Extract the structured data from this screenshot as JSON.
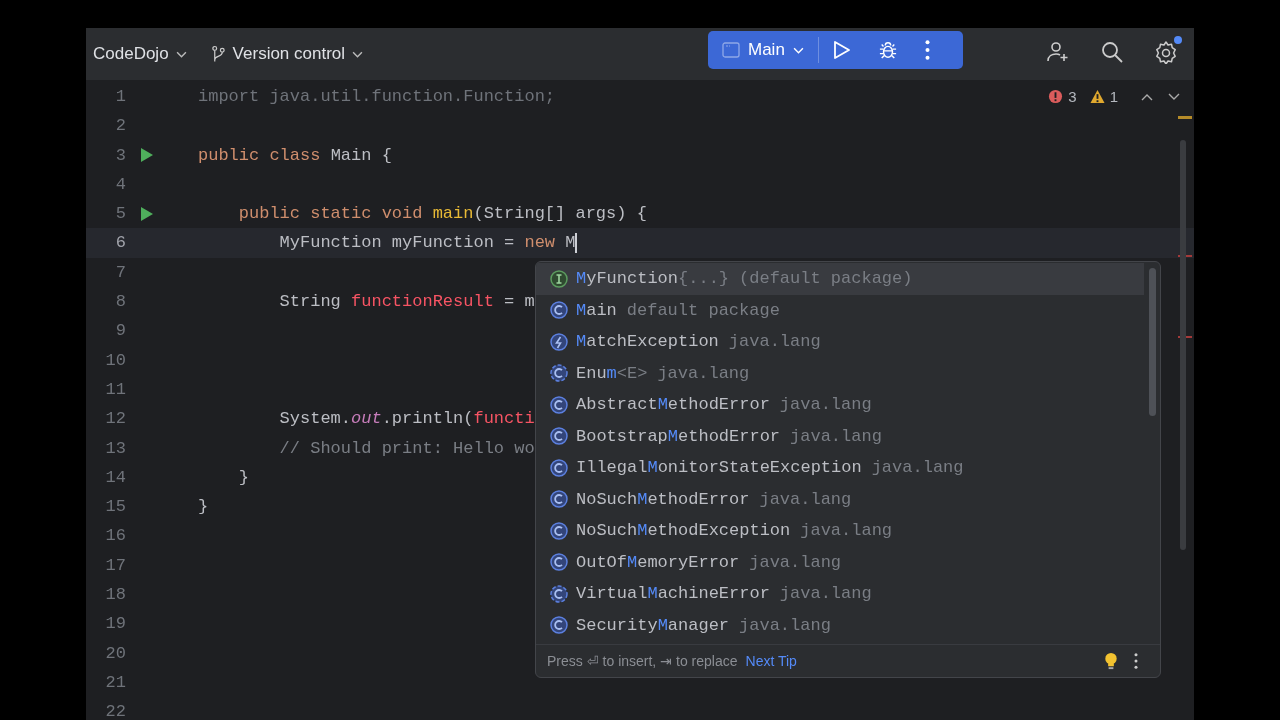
{
  "toolbar": {
    "project": "CodeDojo",
    "vcs": "Version control",
    "run_config": "Main",
    "settings_badge": true
  },
  "inspections": {
    "errors": "3",
    "warnings": "1"
  },
  "lines": [
    {
      "number": "1",
      "run": false,
      "current": false,
      "tokens": [
        {
          "kind": "unused",
          "text": "import java.util.function.Function;"
        }
      ]
    },
    {
      "number": "2",
      "run": false,
      "current": false
    },
    {
      "number": "3",
      "run": true,
      "current": false,
      "tokens": [
        {
          "kind": "keyword",
          "text": "public class "
        },
        {
          "kind": "plain",
          "text": "Main {"
        }
      ]
    },
    {
      "number": "4",
      "run": false,
      "current": false
    },
    {
      "number": "5",
      "run": true,
      "current": false,
      "tokens": [
        {
          "kind": "keyword",
          "text": "    public static void "
        },
        {
          "kind": "method",
          "text": "main"
        },
        {
          "kind": "plain",
          "text": "(String[] args) {"
        }
      ]
    },
    {
      "number": "6",
      "run": false,
      "current": true,
      "tokens": [
        {
          "kind": "plain",
          "text": "        MyFunction myFunction = "
        },
        {
          "kind": "keyword",
          "text": "new "
        },
        {
          "kind": "plain",
          "text": "M"
        }
      ]
    },
    {
      "number": "7",
      "run": false,
      "current": false
    },
    {
      "number": "8",
      "run": false,
      "current": false,
      "tokens": [
        {
          "kind": "plain",
          "text": "        String "
        },
        {
          "kind": "error",
          "text": "functionResult"
        },
        {
          "kind": "plain",
          "text": " = m"
        }
      ]
    },
    {
      "number": "9",
      "run": false,
      "current": false
    },
    {
      "number": "10",
      "run": false,
      "current": false
    },
    {
      "number": "11",
      "run": false,
      "current": false
    },
    {
      "number": "12",
      "run": false,
      "current": false,
      "tokens": [
        {
          "kind": "plain",
          "text": "        System."
        },
        {
          "kind": "static",
          "text": "out"
        },
        {
          "kind": "plain",
          "text": ".println("
        },
        {
          "kind": "error",
          "text": "functi"
        }
      ]
    },
    {
      "number": "13",
      "run": false,
      "current": false,
      "tokens": [
        {
          "kind": "comment",
          "text": "        // Should print: Hello wo"
        }
      ]
    },
    {
      "number": "14",
      "run": false,
      "current": false,
      "tokens": [
        {
          "kind": "plain",
          "text": "    }"
        }
      ]
    },
    {
      "number": "15",
      "run": false,
      "current": false,
      "tokens": [
        {
          "kind": "plain",
          "text": "}"
        }
      ]
    },
    {
      "number": "16",
      "run": false,
      "current": false
    },
    {
      "number": "17",
      "run": false,
      "current": false
    },
    {
      "number": "18",
      "run": false,
      "current": false
    },
    {
      "number": "19",
      "run": false,
      "current": false
    },
    {
      "number": "20",
      "run": false,
      "current": false
    },
    {
      "number": "21",
      "run": false,
      "current": false
    },
    {
      "number": "22",
      "run": false,
      "current": false
    }
  ],
  "completion": {
    "items": [
      {
        "kind": "interface",
        "selected": true,
        "match": "M",
        "rest": "yFunction",
        "tail": "{...}",
        "location": "(default package)"
      },
      {
        "kind": "class",
        "selected": false,
        "match": "M",
        "rest": "ain",
        "location": "default package"
      },
      {
        "kind": "exception",
        "selected": false,
        "match": "M",
        "rest": "atchException",
        "location": "java.lang"
      },
      {
        "kind": "abstract",
        "selected": false,
        "prefix": "Enu",
        "match": "m",
        "tail": "<E>",
        "location": "java.lang"
      },
      {
        "kind": "class",
        "selected": false,
        "prefix": "Abstract",
        "match": "M",
        "rest": "ethodError",
        "location": "java.lang"
      },
      {
        "kind": "class",
        "selected": false,
        "prefix": "Bootstrap",
        "match": "M",
        "rest": "ethodError",
        "location": "java.lang"
      },
      {
        "kind": "class",
        "selected": false,
        "prefix": "Illegal",
        "match": "M",
        "rest": "onitorStateException",
        "location": "java.lang"
      },
      {
        "kind": "class",
        "selected": false,
        "prefix": "NoSuch",
        "match": "M",
        "rest": "ethodError",
        "location": "java.lang"
      },
      {
        "kind": "class",
        "selected": false,
        "prefix": "NoSuch",
        "match": "M",
        "rest": "ethodException",
        "location": "java.lang"
      },
      {
        "kind": "class",
        "selected": false,
        "prefix": "OutOf",
        "match": "M",
        "rest": "emoryError",
        "location": "java.lang"
      },
      {
        "kind": "abstract",
        "selected": false,
        "prefix": "Virtual",
        "match": "M",
        "rest": "achineError",
        "location": "java.lang"
      },
      {
        "kind": "class",
        "selected": false,
        "prefix": "Security",
        "match": "M",
        "rest": "anager",
        "location": "java.lang"
      }
    ],
    "hint": "Press ⏎ to insert, ⇥ to replace",
    "next_tip": "Next Tip"
  }
}
